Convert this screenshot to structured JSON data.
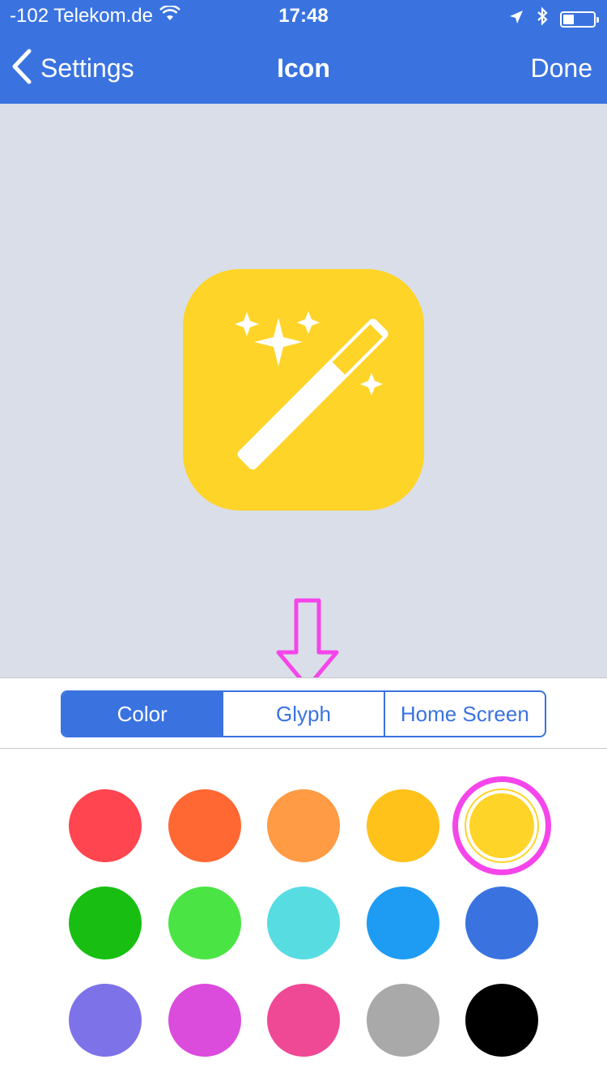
{
  "status_bar": {
    "carrier": "-102 Telekom.de",
    "time": "17:48",
    "battery_level": 0.35,
    "icons": [
      "wifi-icon",
      "location-arrow-icon",
      "bluetooth-icon",
      "battery-icon"
    ]
  },
  "nav": {
    "back_label": "Settings",
    "title": "Icon",
    "done_label": "Done"
  },
  "preview": {
    "icon_color": "#ffd428",
    "glyph": "magic-wand-icon"
  },
  "segments": [
    {
      "label": "Color",
      "active": true
    },
    {
      "label": "Glyph",
      "active": false
    },
    {
      "label": "Home Screen",
      "active": false
    }
  ],
  "colors": {
    "selected_index": 4,
    "swatches": [
      "#ff4550",
      "#ff6733",
      "#ff9a45",
      "#ffc21a",
      "#ffd428",
      "#18bf12",
      "#4ae544",
      "#57dce1",
      "#1e9bf3",
      "#3a73e0",
      "#7e72e8",
      "#db4bdc",
      "#ef4995",
      "#a9a9a9",
      "#000000"
    ]
  },
  "theme": {
    "accent": "#3a73e0",
    "highlight": "#f545ea"
  }
}
